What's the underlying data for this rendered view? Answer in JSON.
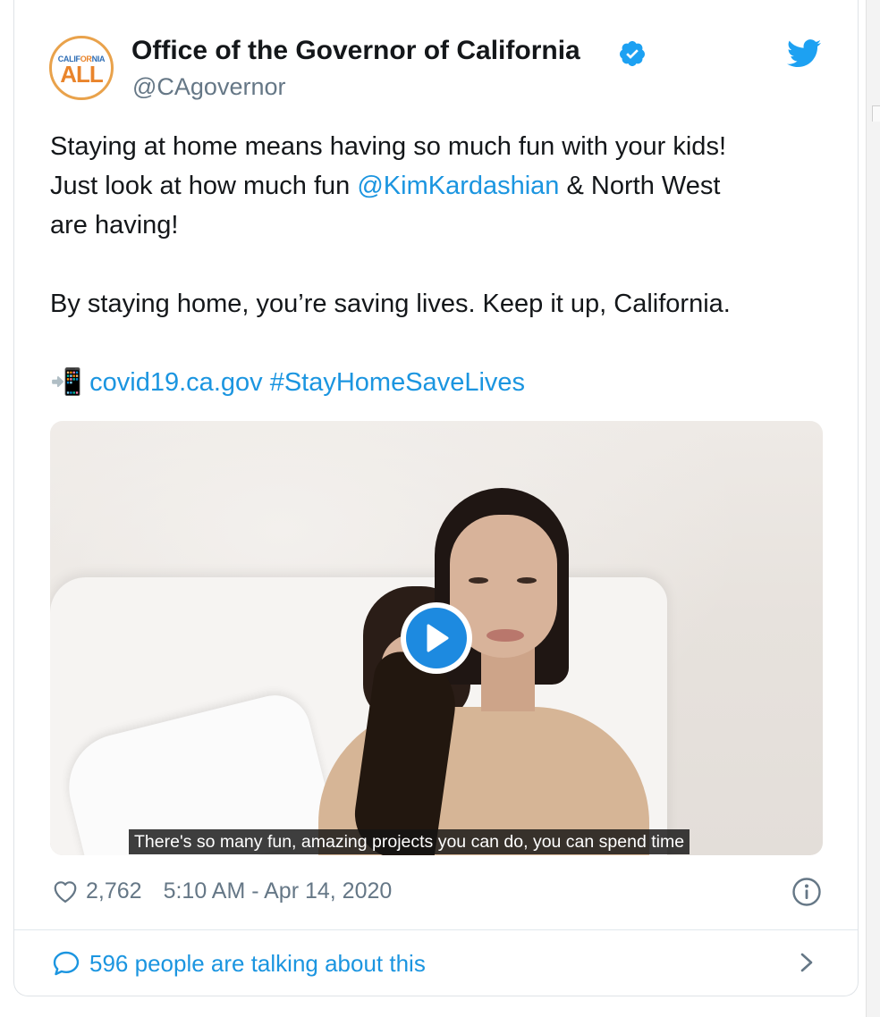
{
  "account": {
    "avatar_top_prefix": "CALIF",
    "avatar_top_mid": "OR",
    "avatar_top_suffix": "NIA",
    "avatar_main": "ALL",
    "display_name": "Office of the Governor of California",
    "handle": "@CAgovernor",
    "verified": true
  },
  "tweet": {
    "line1": "Staying at home means having so much fun with your kids!",
    "line2_before": "Just look at how much fun ",
    "line2_mention": "@KimKardashian",
    "line2_after": " & North West",
    "line3": "are having!",
    "line4": "By staying home, you’re saving lives. Keep it up, California.",
    "link_emoji": "📲",
    "link_url": "covid19.ca.gov",
    "hashtag": "#StayHomeSaveLives"
  },
  "media": {
    "subtitle": "There's so many fun, amazing projects you can do, you can spend time"
  },
  "footer": {
    "likes": "2,762",
    "timestamp": "5:10 AM - Apr 14, 2020"
  },
  "conversation": {
    "label": "596 people are talking about this"
  },
  "colors": {
    "link": "#1b95e0",
    "text": "#14171a",
    "muted": "#657786",
    "border": "#e1e8ed"
  },
  "icons": [
    "twitter-bird-icon",
    "verified-badge-icon",
    "play-icon",
    "heart-icon",
    "info-icon",
    "speech-bubble-icon",
    "chevron-right-icon"
  ]
}
